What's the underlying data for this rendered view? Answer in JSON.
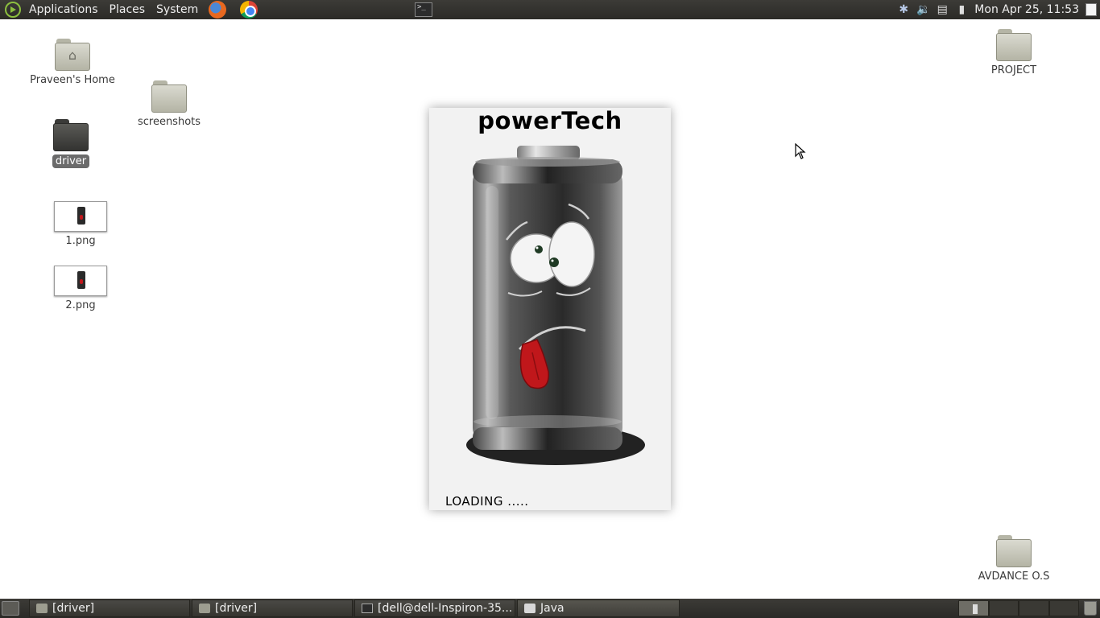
{
  "top_panel": {
    "menus": [
      "Applications",
      "Places",
      "System"
    ],
    "clock": "Mon Apr 25, 11:53"
  },
  "desktop_icons": {
    "home": "Praveen's Home",
    "screenshots": "screenshots",
    "driver": "driver",
    "png1": "1.png",
    "png2": "2.png",
    "project": "PROJECT",
    "advance_os": "AVDANCE O.S"
  },
  "splash": {
    "title": "powerTech",
    "loading": "LOADING ....."
  },
  "taskbar": {
    "tasks": [
      "[driver]",
      "[driver]",
      "[dell@dell-Inspiron-35...",
      "Java"
    ]
  },
  "icons": {
    "apps_logo": "mint-logo-icon",
    "firefox": "firefox-icon",
    "chrome": "chrome-icon",
    "terminal": "terminal-icon",
    "bluetooth": "bluetooth-icon",
    "volume": "volume-icon",
    "network": "network-icon",
    "battery": "battery-icon",
    "shutdown": "shutdown-icon",
    "show_desktop": "show-desktop-icon",
    "trash": "trash-icon"
  },
  "colors": {
    "panel_bg": "#3c3b37",
    "selection": "#6b6b6b",
    "tongue": "#c0171b"
  }
}
